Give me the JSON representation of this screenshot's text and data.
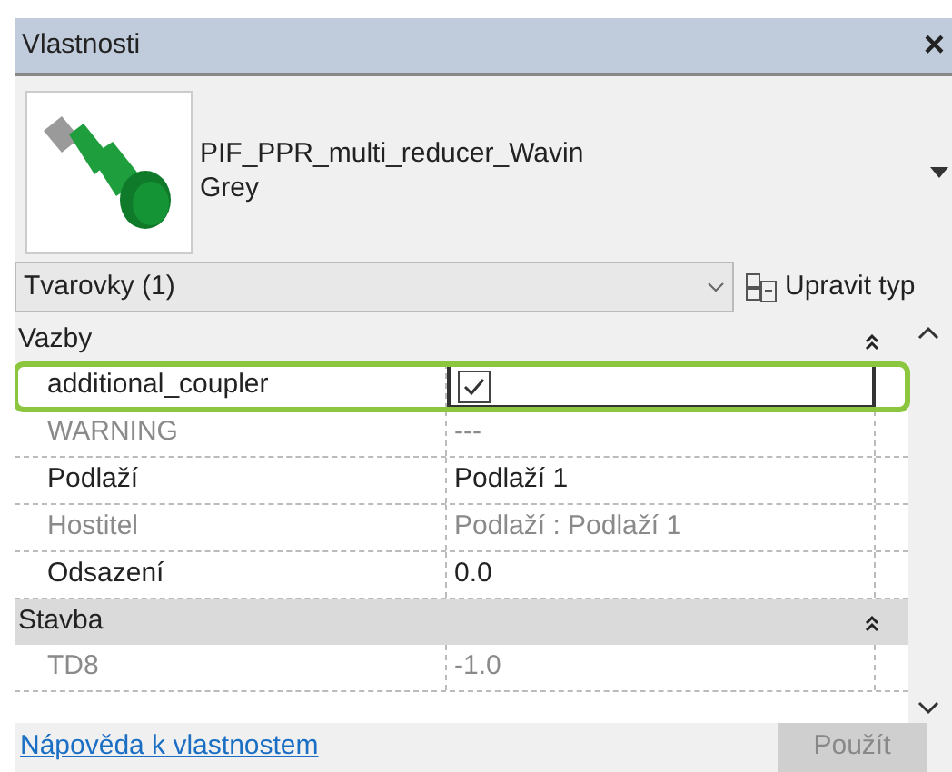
{
  "window": {
    "title": "Vlastnosti",
    "close": "×"
  },
  "element": {
    "family": "PIF_PPR_multi_reducer_Wavin",
    "type": "Grey"
  },
  "selector": {
    "value": "Tvarovky (1)",
    "edit_type": "Upravit typ"
  },
  "groups": [
    {
      "name": "Vazby",
      "expanded": true,
      "rows": [
        {
          "name": "additional_coupler",
          "kind": "checkbox",
          "checked": true,
          "editing": true,
          "highlighted": true,
          "readonly": false
        },
        {
          "name": "WARNING",
          "kind": "text",
          "value": "---",
          "readonly": true
        },
        {
          "name": "Podlaží",
          "kind": "text",
          "value": "Podlaží 1",
          "readonly": false
        },
        {
          "name": "Hostitel",
          "kind": "text",
          "value": "Podlaží : Podlaží 1",
          "readonly": true
        },
        {
          "name": "Odsazení",
          "kind": "text",
          "value": "0.0",
          "readonly": false
        }
      ]
    },
    {
      "name": "Stavba",
      "expanded": true,
      "rows": [
        {
          "name": "TD8",
          "kind": "text",
          "value": "-1.0",
          "readonly": true
        }
      ]
    }
  ],
  "footer": {
    "help_link": "Nápověda k vlastnostem",
    "apply": {
      "label": "Použít",
      "disabled": true
    }
  }
}
